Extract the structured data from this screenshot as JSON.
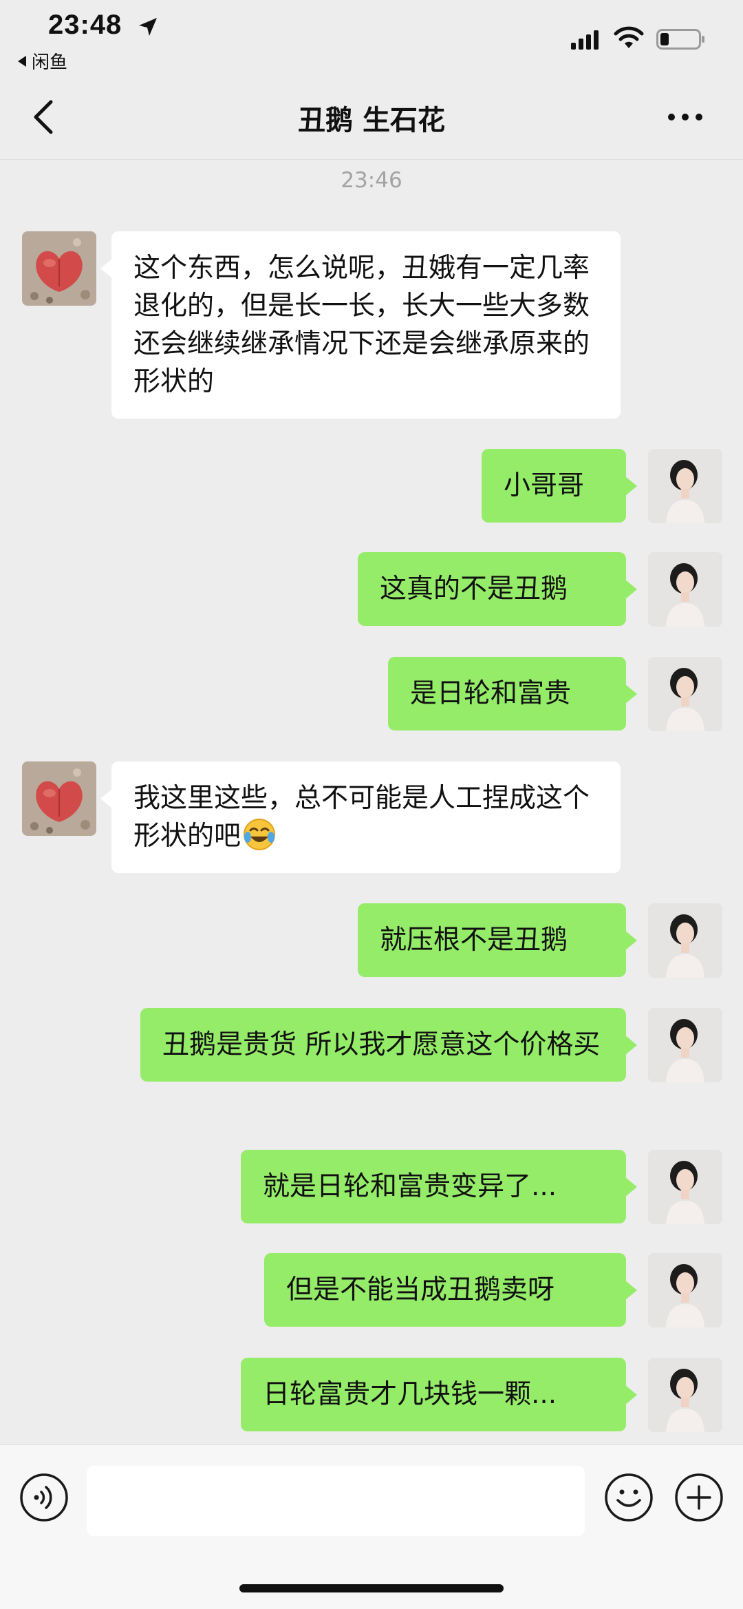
{
  "status_bar": {
    "time": "23:48",
    "back_app_label": "闲鱼"
  },
  "nav": {
    "title": "丑鹅 生石花"
  },
  "chat": {
    "timestamp": "23:46",
    "messages": [
      {
        "side": "left",
        "text": "这个东西，怎么说呢，丑娥有一定几率退化的，但是长一长，长大一些大多数还会继续继承情况下还是会继承原来的形状的"
      },
      {
        "side": "right",
        "text": "小哥哥"
      },
      {
        "side": "right",
        "text": "这真的不是丑鹅"
      },
      {
        "side": "right",
        "text": "是日轮和富贵"
      },
      {
        "side": "left",
        "text": "我这里这些，总不可能是人工捏成这个形状的吧",
        "emoji": "tears-of-joy-emoji"
      },
      {
        "side": "right",
        "text": "就压根不是丑鹅"
      },
      {
        "side": "right",
        "text": "丑鹅是贵货 所以我才愿意这个价格买"
      },
      {
        "side": "right",
        "text": "就是日轮和富贵变异了..."
      },
      {
        "side": "right",
        "text": "但是不能当成丑鹅卖呀"
      },
      {
        "side": "right",
        "text": "日轮富贵才几块钱一颗..."
      }
    ]
  },
  "input_bar": {
    "message_value": "",
    "icons": [
      "voice-icon",
      "emoji-icon",
      "plus-icon"
    ]
  },
  "colors": {
    "background": "#ededed",
    "bubble_sent": "#95ec69",
    "bubble_received": "#ffffff",
    "timestamp_text": "#a3a3a3"
  }
}
